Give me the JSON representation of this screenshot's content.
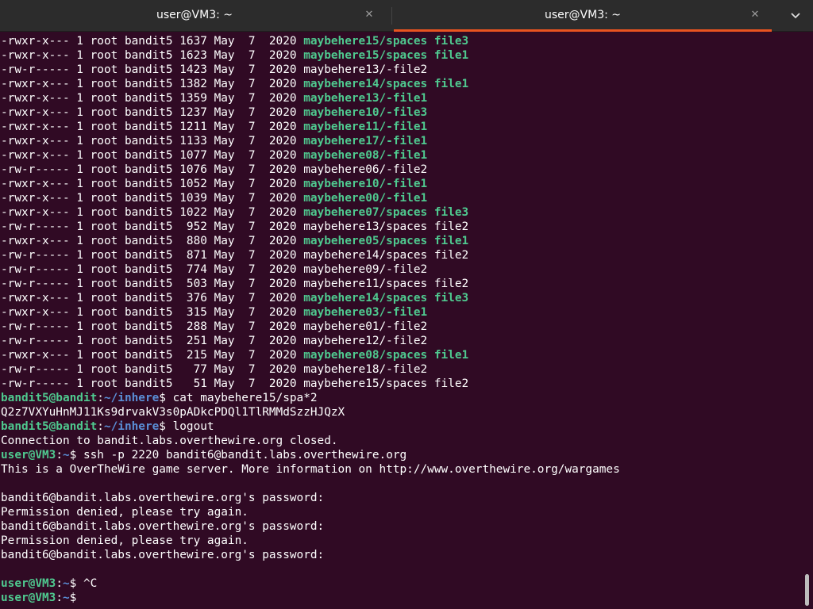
{
  "tabs": [
    {
      "title": "user@VM3: ~",
      "active": false
    },
    {
      "title": "user@VM3: ~",
      "active": true
    }
  ],
  "colors": {
    "background": "#300a24",
    "tabbar": "#2c2c2c",
    "accent": "#e95420",
    "executable": "#4fc98f",
    "path": "#5a8ed6"
  },
  "icons": {
    "tab_close": "close-icon",
    "tabs_menu": "chevron-down-icon"
  },
  "listing": [
    {
      "perm": "-rwxr-x---",
      "links": "1",
      "owner": "root",
      "group": "bandit5",
      "size": "1637",
      "month": "May",
      "day": " 7",
      "year": "2020",
      "name": "maybehere15/spaces file3",
      "exec": true
    },
    {
      "perm": "-rwxr-x---",
      "links": "1",
      "owner": "root",
      "group": "bandit5",
      "size": "1623",
      "month": "May",
      "day": " 7",
      "year": "2020",
      "name": "maybehere15/spaces file1",
      "exec": true
    },
    {
      "perm": "-rw-r-----",
      "links": "1",
      "owner": "root",
      "group": "bandit5",
      "size": "1423",
      "month": "May",
      "day": " 7",
      "year": "2020",
      "name": "maybehere13/-file2",
      "exec": false
    },
    {
      "perm": "-rwxr-x---",
      "links": "1",
      "owner": "root",
      "group": "bandit5",
      "size": "1382",
      "month": "May",
      "day": " 7",
      "year": "2020",
      "name": "maybehere14/spaces file1",
      "exec": true
    },
    {
      "perm": "-rwxr-x---",
      "links": "1",
      "owner": "root",
      "group": "bandit5",
      "size": "1359",
      "month": "May",
      "day": " 7",
      "year": "2020",
      "name": "maybehere13/-file1",
      "exec": true
    },
    {
      "perm": "-rwxr-x---",
      "links": "1",
      "owner": "root",
      "group": "bandit5",
      "size": "1237",
      "month": "May",
      "day": " 7",
      "year": "2020",
      "name": "maybehere10/-file3",
      "exec": true
    },
    {
      "perm": "-rwxr-x---",
      "links": "1",
      "owner": "root",
      "group": "bandit5",
      "size": "1211",
      "month": "May",
      "day": " 7",
      "year": "2020",
      "name": "maybehere11/-file1",
      "exec": true
    },
    {
      "perm": "-rwxr-x---",
      "links": "1",
      "owner": "root",
      "group": "bandit5",
      "size": "1133",
      "month": "May",
      "day": " 7",
      "year": "2020",
      "name": "maybehere17/-file1",
      "exec": true
    },
    {
      "perm": "-rwxr-x---",
      "links": "1",
      "owner": "root",
      "group": "bandit5",
      "size": "1077",
      "month": "May",
      "day": " 7",
      "year": "2020",
      "name": "maybehere08/-file1",
      "exec": true
    },
    {
      "perm": "-rw-r-----",
      "links": "1",
      "owner": "root",
      "group": "bandit5",
      "size": "1076",
      "month": "May",
      "day": " 7",
      "year": "2020",
      "name": "maybehere06/-file2",
      "exec": false
    },
    {
      "perm": "-rwxr-x---",
      "links": "1",
      "owner": "root",
      "group": "bandit5",
      "size": "1052",
      "month": "May",
      "day": " 7",
      "year": "2020",
      "name": "maybehere10/-file1",
      "exec": true
    },
    {
      "perm": "-rwxr-x---",
      "links": "1",
      "owner": "root",
      "group": "bandit5",
      "size": "1039",
      "month": "May",
      "day": " 7",
      "year": "2020",
      "name": "maybehere00/-file1",
      "exec": true
    },
    {
      "perm": "-rwxr-x---",
      "links": "1",
      "owner": "root",
      "group": "bandit5",
      "size": "1022",
      "month": "May",
      "day": " 7",
      "year": "2020",
      "name": "maybehere07/spaces file3",
      "exec": true
    },
    {
      "perm": "-rw-r-----",
      "links": "1",
      "owner": "root",
      "group": "bandit5",
      "size": " 952",
      "month": "May",
      "day": " 7",
      "year": "2020",
      "name": "maybehere13/spaces file2",
      "exec": false
    },
    {
      "perm": "-rwxr-x---",
      "links": "1",
      "owner": "root",
      "group": "bandit5",
      "size": " 880",
      "month": "May",
      "day": " 7",
      "year": "2020",
      "name": "maybehere05/spaces file1",
      "exec": true
    },
    {
      "perm": "-rw-r-----",
      "links": "1",
      "owner": "root",
      "group": "bandit5",
      "size": " 871",
      "month": "May",
      "day": " 7",
      "year": "2020",
      "name": "maybehere14/spaces file2",
      "exec": false
    },
    {
      "perm": "-rw-r-----",
      "links": "1",
      "owner": "root",
      "group": "bandit5",
      "size": " 774",
      "month": "May",
      "day": " 7",
      "year": "2020",
      "name": "maybehere09/-file2",
      "exec": false
    },
    {
      "perm": "-rw-r-----",
      "links": "1",
      "owner": "root",
      "group": "bandit5",
      "size": " 503",
      "month": "May",
      "day": " 7",
      "year": "2020",
      "name": "maybehere11/spaces file2",
      "exec": false
    },
    {
      "perm": "-rwxr-x---",
      "links": "1",
      "owner": "root",
      "group": "bandit5",
      "size": " 376",
      "month": "May",
      "day": " 7",
      "year": "2020",
      "name": "maybehere14/spaces file3",
      "exec": true
    },
    {
      "perm": "-rwxr-x---",
      "links": "1",
      "owner": "root",
      "group": "bandit5",
      "size": " 315",
      "month": "May",
      "day": " 7",
      "year": "2020",
      "name": "maybehere03/-file1",
      "exec": true
    },
    {
      "perm": "-rw-r-----",
      "links": "1",
      "owner": "root",
      "group": "bandit5",
      "size": " 288",
      "month": "May",
      "day": " 7",
      "year": "2020",
      "name": "maybehere01/-file2",
      "exec": false
    },
    {
      "perm": "-rw-r-----",
      "links": "1",
      "owner": "root",
      "group": "bandit5",
      "size": " 251",
      "month": "May",
      "day": " 7",
      "year": "2020",
      "name": "maybehere12/-file2",
      "exec": false
    },
    {
      "perm": "-rwxr-x---",
      "links": "1",
      "owner": "root",
      "group": "bandit5",
      "size": " 215",
      "month": "May",
      "day": " 7",
      "year": "2020",
      "name": "maybehere08/spaces file1",
      "exec": true
    },
    {
      "perm": "-rw-r-----",
      "links": "1",
      "owner": "root",
      "group": "bandit5",
      "size": "  77",
      "month": "May",
      "day": " 7",
      "year": "2020",
      "name": "maybehere18/-file2",
      "exec": false
    },
    {
      "perm": "-rw-r-----",
      "links": "1",
      "owner": "root",
      "group": "bandit5",
      "size": "  51",
      "month": "May",
      "day": " 7",
      "year": "2020",
      "name": "maybehere15/spaces file2",
      "exec": false
    }
  ],
  "session": [
    {
      "kind": "prompt",
      "user": "bandit5@bandit",
      "path": "~/inhere",
      "symbol": "$ ",
      "cmd": "cat maybehere15/spa*2"
    },
    {
      "kind": "output",
      "text": "Q2z7VXYuHnMJ11Ks9drvakV3s0pADkcPDQl1TlRMMdSzzHJQzX"
    },
    {
      "kind": "prompt",
      "user": "bandit5@bandit",
      "path": "~/inhere",
      "symbol": "$ ",
      "cmd": "logout"
    },
    {
      "kind": "output",
      "text": "Connection to bandit.labs.overthewire.org closed."
    },
    {
      "kind": "prompt",
      "user": "user@VM3",
      "path": "~",
      "symbol": "$ ",
      "cmd": "ssh -p 2220 bandit6@bandit.labs.overthewire.org"
    },
    {
      "kind": "output",
      "text": "This is a OverTheWire game server. More information on http://www.overthewire.org/wargames"
    },
    {
      "kind": "output",
      "text": ""
    },
    {
      "kind": "output",
      "text": "bandit6@bandit.labs.overthewire.org's password:"
    },
    {
      "kind": "output",
      "text": "Permission denied, please try again."
    },
    {
      "kind": "output",
      "text": "bandit6@bandit.labs.overthewire.org's password:"
    },
    {
      "kind": "output",
      "text": "Permission denied, please try again."
    },
    {
      "kind": "output",
      "text": "bandit6@bandit.labs.overthewire.org's password:"
    },
    {
      "kind": "output",
      "text": ""
    },
    {
      "kind": "prompt",
      "user": "user@VM3",
      "path": "~",
      "symbol": "$ ",
      "cmd": "^C"
    },
    {
      "kind": "prompt",
      "user": "user@VM3",
      "path": "~",
      "symbol": "$ ",
      "cmd": ""
    }
  ]
}
